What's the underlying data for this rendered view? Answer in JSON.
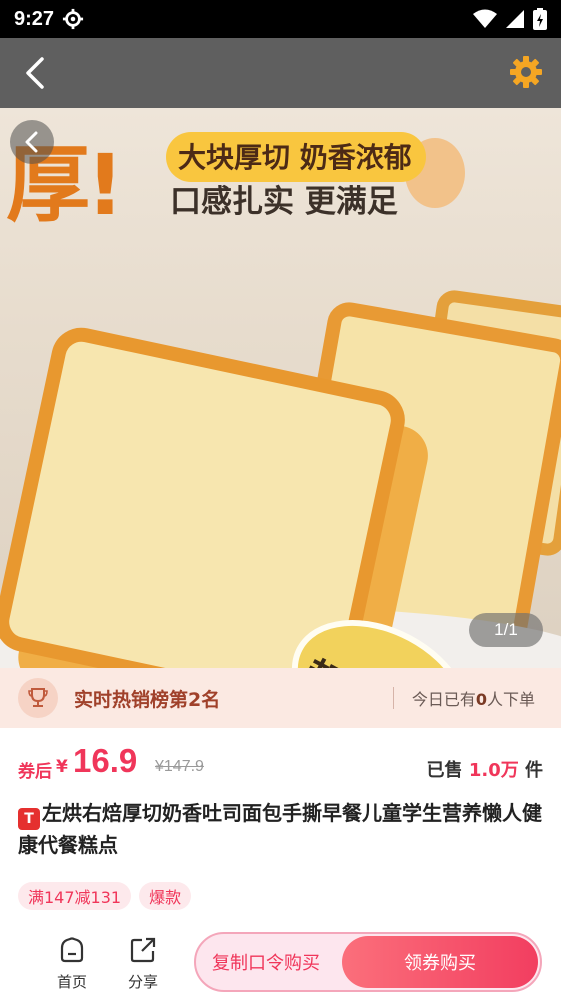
{
  "status_bar": {
    "time": "9:27"
  },
  "hero": {
    "big_char": "厚!",
    "headline1": "大块厚切 奶香浓郁",
    "headline2": "口感扎实 更满足",
    "badge": "超厚实",
    "pager": "1/1"
  },
  "rank": {
    "text": "实时热销榜第2名",
    "today_prefix": "今日已有",
    "today_count": "0",
    "today_suffix": "人下单"
  },
  "price": {
    "label": "券后",
    "yen": "¥",
    "value": "16.9",
    "original": "¥147.9",
    "sold_prefix": "已售",
    "sold_num": "1.0万",
    "sold_suffix": "件"
  },
  "product": {
    "platform_badge": "T",
    "title": "左烘右焙厚切奶香吐司面包手撕早餐儿童学生营养懒人健康代餐糕点"
  },
  "tags": [
    "满147减131",
    "爆款"
  ],
  "bottom": {
    "home": "首页",
    "share": "分享",
    "copy_buy": "复制口令购买",
    "coupon_buy": "领券购买"
  },
  "colors": {
    "accent": "#f0365a",
    "status_bar": "#000000",
    "title_bar": "#5f5f5f",
    "settings": "#f5a623"
  }
}
